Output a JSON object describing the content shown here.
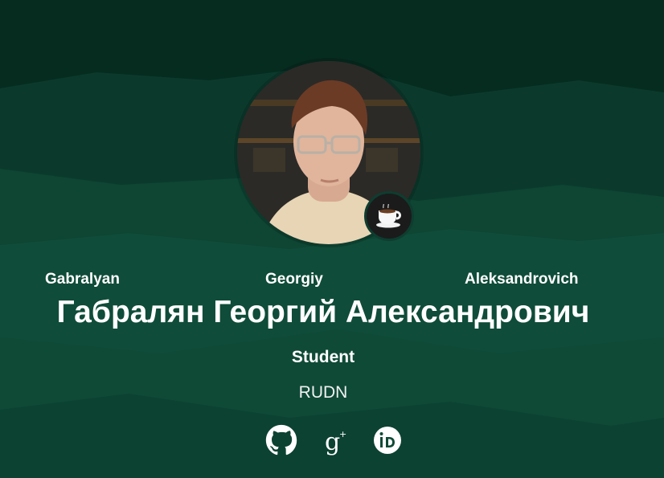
{
  "profile": {
    "name_parts_latin": [
      "Gabralyan",
      "Georgiy",
      "Aleksandrovich"
    ],
    "full_name": "Габралян Георгий Александрович",
    "role": "Student",
    "organization": "RUDN",
    "avatar_alt": "Profile photo",
    "badge_icon": "coffee-cup-icon"
  },
  "links": [
    {
      "icon": "github-icon",
      "label": "GitHub"
    },
    {
      "icon": "google-scholar-icon",
      "label": "Google Scholar"
    },
    {
      "icon": "orcid-icon",
      "label": "ORCID"
    }
  ],
  "colors": {
    "background_dark": "#0b3a2c",
    "background_mid": "#0f4a37",
    "background_light": "#12563f",
    "text": "#ffffff"
  }
}
